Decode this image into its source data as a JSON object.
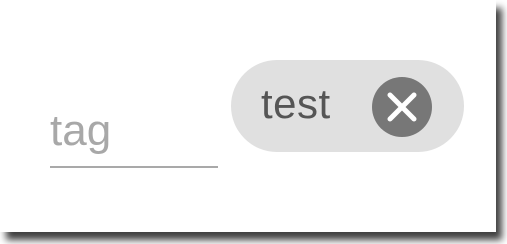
{
  "tag_input": {
    "value": "",
    "placeholder": "tag"
  },
  "chips": [
    {
      "label": "test",
      "remove_icon": "close-circle-icon"
    }
  ],
  "colors": {
    "chip_background": "#e0e0e0",
    "chip_text": "#555555",
    "remove_icon_background": "#777777",
    "placeholder_text": "#a8a8a8",
    "input_underline": "#a9a9a9"
  }
}
